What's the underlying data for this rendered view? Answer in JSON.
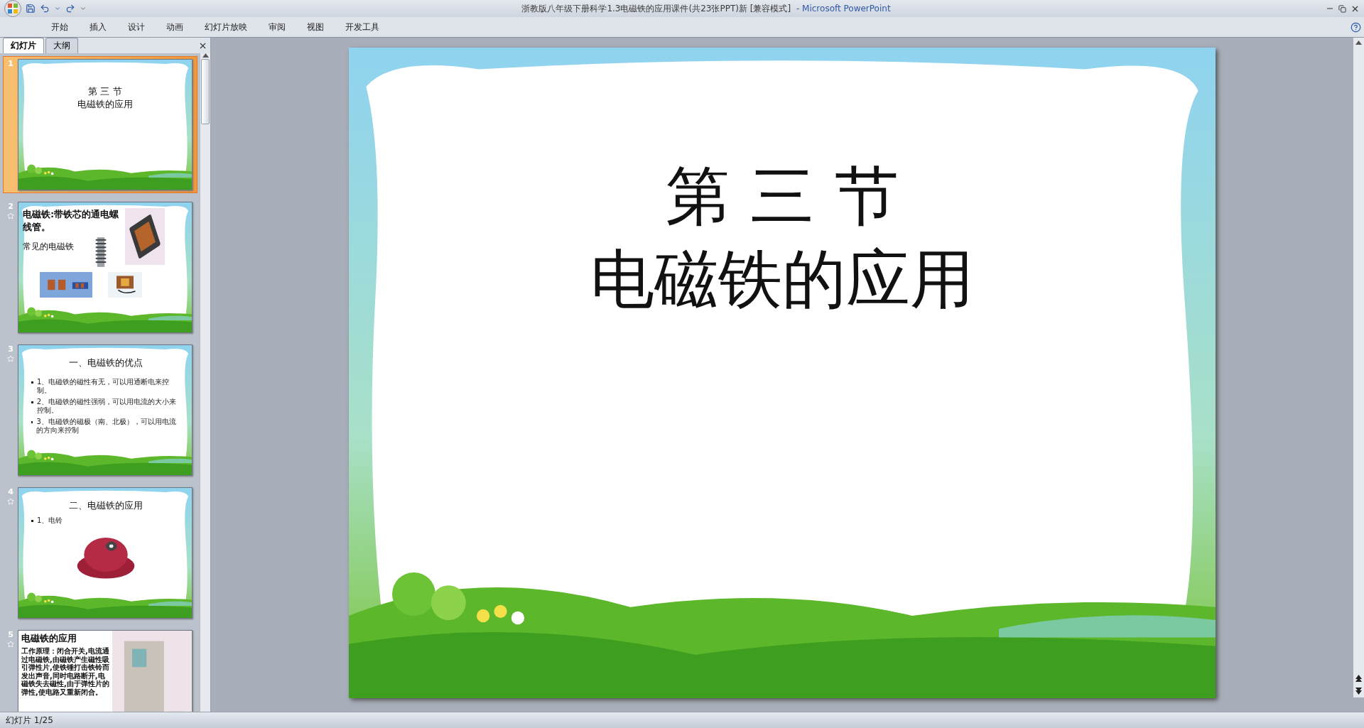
{
  "window": {
    "title": "浙教版八年级下册科学1.3电磁铁的应用课件(共23张PPT)新 [兼容模式]",
    "app": "- Microsoft PowerPoint"
  },
  "ribbon_tabs": [
    {
      "label": "开始",
      "selected": false
    },
    {
      "label": "插入",
      "selected": false
    },
    {
      "label": "设计",
      "selected": false
    },
    {
      "label": "动画",
      "selected": false
    },
    {
      "label": "幻灯片放映",
      "selected": false
    },
    {
      "label": "审阅",
      "selected": false
    },
    {
      "label": "视图",
      "selected": false
    },
    {
      "label": "开发工具",
      "selected": false
    }
  ],
  "panel_tabs": [
    {
      "label": "幻灯片",
      "selected": true
    },
    {
      "label": "大纲",
      "selected": false
    }
  ],
  "slides": [
    {
      "number": "1",
      "selected": true,
      "animated": false,
      "kind": "title",
      "lines": [
        "第 三 节",
        "电磁铁的应用"
      ]
    },
    {
      "number": "2",
      "selected": false,
      "animated": true,
      "kind": "pictures",
      "heading": "电磁铁:带铁芯的通电螺线管。",
      "caption": "常见的电磁铁"
    },
    {
      "number": "3",
      "selected": false,
      "animated": true,
      "kind": "bullets",
      "heading": "一、电磁铁的优点",
      "bullets": [
        "1、电磁铁的磁性有无，可以用通断电来控制。",
        "2、电磁铁的磁性强弱，可以用电流的大小来控制。",
        "3、电磁铁的磁极（南、北极），可以用电流的方向来控制"
      ]
    },
    {
      "number": "4",
      "selected": false,
      "animated": true,
      "kind": "bullets_picture",
      "heading": "二、电磁铁的应用",
      "bullets": [
        "1、电铃"
      ]
    },
    {
      "number": "5",
      "selected": false,
      "animated": true,
      "kind": "text_picture",
      "heading": "电磁铁的应用",
      "body": "工作原理：闭合开关,电流通过电磁铁,由磁铁产生磁性吸引弹性片,使铁锤打击铁铃而发出声音,同时电路断开,电磁铁失去磁性,由于弹性片的弹性,使电路又重新闭合。"
    }
  ],
  "current_slide": {
    "lines": [
      "第 三 节",
      "电磁铁的应用"
    ]
  },
  "status_bar": {
    "text": "幻灯片 1/25"
  }
}
